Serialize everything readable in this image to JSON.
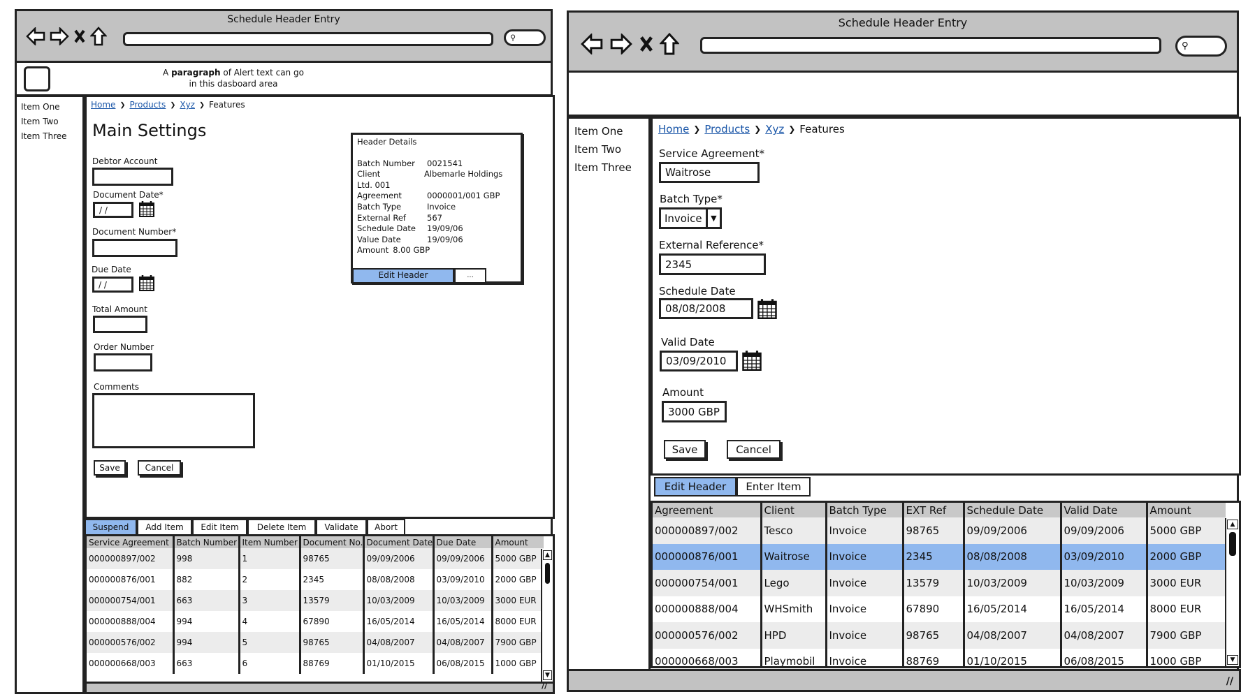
{
  "left_window": {
    "title": "Schedule Header Entry",
    "nav": {
      "back_icon": "back-arrow-icon",
      "forward_icon": "forward-arrow-icon",
      "stop_icon": "close-x-icon",
      "home_icon": "home-icon",
      "search_icon": "search-icon"
    },
    "url": "",
    "alert": {
      "icon": "alert-box-icon",
      "text_before": "A ",
      "text_bold": "paragraph",
      "text_after": " of Alert text can go",
      "line2": "in this dasboard area"
    },
    "sidebar": {
      "items": [
        {
          "label": "Item One"
        },
        {
          "label": "Item Two"
        },
        {
          "label": "Item Three"
        }
      ]
    },
    "breadcrumb": {
      "items": [
        {
          "label": "Home",
          "link": true
        },
        {
          "label": "Products",
          "link": true
        },
        {
          "label": "Xyz",
          "link": true
        },
        {
          "label": "Features",
          "link": false
        }
      ],
      "separator": "❯"
    },
    "page_title": "Main Settings",
    "form": {
      "debtor_account": {
        "label": "Debtor Account",
        "value": ""
      },
      "document_date": {
        "label": "Document Date*",
        "value": " /  /"
      },
      "document_number": {
        "label": "Document Number*",
        "value": ""
      },
      "due_date": {
        "label": "Due Date",
        "value": " /  /"
      },
      "total_amount": {
        "label": "Total Amount",
        "value": ""
      },
      "order_number": {
        "label": "Order Number",
        "value": ""
      },
      "comments": {
        "label": "Comments",
        "value": ""
      },
      "save_label": "Save",
      "cancel_label": "Cancel"
    },
    "header_details": {
      "title": "Header Details",
      "rows": [
        {
          "key": "Batch Number",
          "value": "0021541"
        },
        {
          "key": "Client",
          "value": "Albemarle Holdings"
        },
        {
          "key": "Ltd. 001",
          "value": ""
        },
        {
          "key": "Agreement",
          "value": "0000001/001 GBP"
        },
        {
          "key": "Batch Type",
          "value": "Invoice"
        },
        {
          "key": "External Ref",
          "value": "567"
        },
        {
          "key": "Schedule Date",
          "value": "19/09/06"
        },
        {
          "key": "Value Date",
          "value": "19/09/06"
        },
        {
          "key": "Amount",
          "value": "8.00 GBP"
        }
      ],
      "edit_header_label": "Edit Header",
      "more_label": "..."
    },
    "tabs": [
      {
        "label": "Suspend",
        "active": true
      },
      {
        "label": "Add Item",
        "active": false
      },
      {
        "label": "Edit Item",
        "active": false
      },
      {
        "label": "Delete Item",
        "active": false
      },
      {
        "label": "Validate",
        "active": false
      },
      {
        "label": "Abort",
        "active": false
      }
    ],
    "table": {
      "columns": [
        "Service Agreement",
        "Batch Number",
        "Item Number",
        "Document No.",
        "Document Date",
        "Due Date",
        "Amount"
      ],
      "rows": [
        [
          "000000897/002",
          "998",
          "1",
          "98765",
          "09/09/2006",
          "09/09/2006",
          "5000 GBP"
        ],
        [
          "000000876/001",
          "882",
          "2",
          "2345",
          "08/08/2008",
          "03/09/2010",
          "2000 GBP"
        ],
        [
          "000000754/001",
          "663",
          "3",
          "13579",
          "10/03/2009",
          "10/03/2009",
          "3000 EUR"
        ],
        [
          "000000888/004",
          "994",
          "4",
          "67890",
          "16/05/2014",
          "16/05/2014",
          "8000 EUR"
        ],
        [
          "000000576/002",
          "994",
          "5",
          "98765",
          "04/08/2007",
          "04/08/2007",
          "7900 GBP"
        ],
        [
          "000000668/003",
          "663",
          "6",
          "88769",
          "01/10/2015",
          "06/08/2015",
          "1000 GBP"
        ]
      ]
    },
    "status_grip": "//"
  },
  "right_window": {
    "title": "Schedule Header Entry",
    "url": "",
    "sidebar": {
      "items": [
        {
          "label": "Item One"
        },
        {
          "label": "Item Two"
        },
        {
          "label": "Item Three"
        }
      ]
    },
    "breadcrumb": {
      "items": [
        {
          "label": "Home",
          "link": true
        },
        {
          "label": "Products",
          "link": true
        },
        {
          "label": "Xyz",
          "link": true
        },
        {
          "label": "Features",
          "link": false
        }
      ],
      "separator": "❯"
    },
    "form": {
      "service_agreement": {
        "label": "Service Agreement*",
        "value": "Waitrose"
      },
      "batch_type": {
        "label": "Batch Type*",
        "value": "Invoice"
      },
      "external_reference": {
        "label": "External Reference*",
        "value": "2345"
      },
      "schedule_date": {
        "label": "Schedule Date",
        "value": "08/08/2008"
      },
      "valid_date": {
        "label": "Valid Date",
        "value": "03/09/2010"
      },
      "amount": {
        "label": "Amount",
        "value": "3000 GBP"
      },
      "save_label": "Save",
      "cancel_label": "Cancel"
    },
    "tabs": [
      {
        "label": "Edit Header",
        "active": true
      },
      {
        "label": "Enter Item",
        "active": false
      }
    ],
    "table": {
      "columns": [
        "Agreement",
        "Client",
        "Batch Type",
        "EXT Ref",
        "Schedule Date",
        "Valid Date",
        "Amount"
      ],
      "selected_row": 1,
      "rows": [
        [
          "000000897/002",
          "Tesco",
          "Invoice",
          "98765",
          "09/09/2006",
          "09/09/2006",
          "5000 GBP"
        ],
        [
          "000000876/001",
          "Waitrose",
          "Invoice",
          "2345",
          "08/08/2008",
          "03/09/2010",
          "2000 GBP"
        ],
        [
          "000000754/001",
          "Lego",
          "Invoice",
          "13579",
          "10/03/2009",
          "10/03/2009",
          "3000 EUR"
        ],
        [
          "000000888/004",
          "WHSmith",
          "Invoice",
          "67890",
          "16/05/2014",
          "16/05/2014",
          "8000 EUR"
        ],
        [
          "000000576/002",
          "HPD",
          "Invoice",
          "98765",
          "04/08/2007",
          "04/08/2007",
          "7900 GBP"
        ],
        [
          "000000668/003",
          "Playmobil",
          "Invoice",
          "88769",
          "01/10/2015",
          "06/08/2015",
          "1000 GBP"
        ]
      ]
    },
    "status_grip": "//"
  },
  "colors": {
    "active_tab": "#90b8ee",
    "chrome_gray": "#c2c2c2",
    "link": "#1a56a8",
    "header_gray": "#c8c8c8",
    "row_alt": "#ececec"
  }
}
